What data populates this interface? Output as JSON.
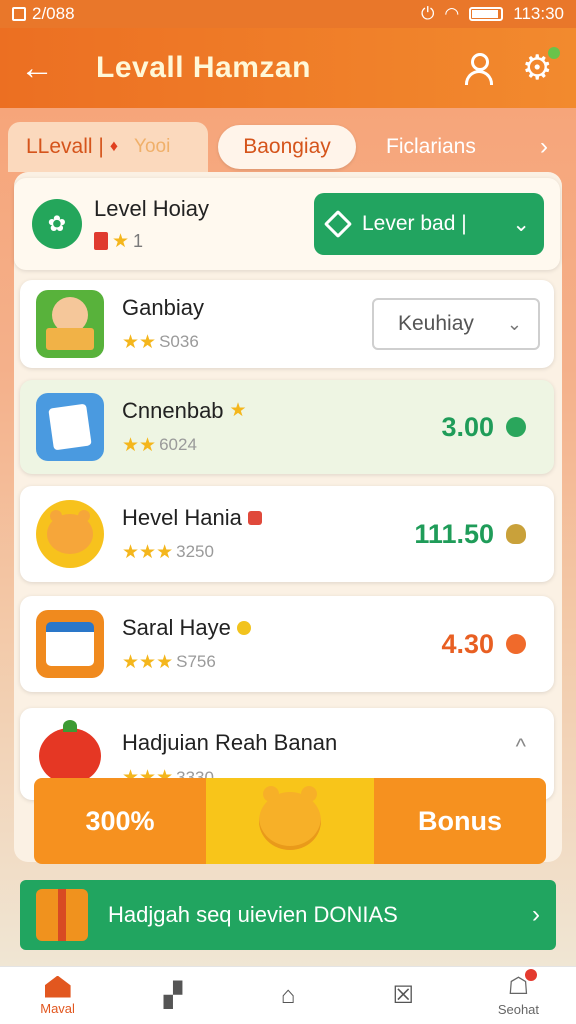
{
  "status_bar": {
    "left_text": "2/088",
    "time": "113:30"
  },
  "header": {
    "title": "Levall Hamzan"
  },
  "tabs": [
    {
      "label": "LLevall |",
      "sub": "Yooi"
    },
    {
      "label": "Baongiay"
    },
    {
      "label": "Ficlarians"
    }
  ],
  "top_card": {
    "title": "Level Hoiay",
    "sub_count": "1",
    "button_label": "Lever bad |"
  },
  "items": [
    {
      "title": "Ganbiay",
      "sub": "S036",
      "dropdown_value": "Keuhiay"
    },
    {
      "title": "Cnnenbab",
      "sub": "6024",
      "value": "3.00"
    },
    {
      "title": "Hevel Hania",
      "sub": "3250",
      "value": "111.50"
    },
    {
      "title": "Saral Haye",
      "sub": "S756",
      "value": "4.30"
    },
    {
      "title": "Hadjuian Reah Banan",
      "sub": "3330"
    }
  ],
  "promo": {
    "left_label": "300%",
    "right_label": "Bonus"
  },
  "banner": {
    "text": "Hadjgah seq uievien DONIAS"
  },
  "bottom_nav": [
    {
      "label": "Maval",
      "icon": "home-icon"
    },
    {
      "label": "",
      "icon": "map-icon"
    },
    {
      "label": "",
      "icon": "house-outline-icon"
    },
    {
      "label": "",
      "icon": "checkbox-icon"
    },
    {
      "label": "Seohat",
      "icon": "chat-icon"
    }
  ],
  "colors": {
    "accent": "#e9772a",
    "green": "#21a560",
    "value_orange": "#e85f22"
  }
}
